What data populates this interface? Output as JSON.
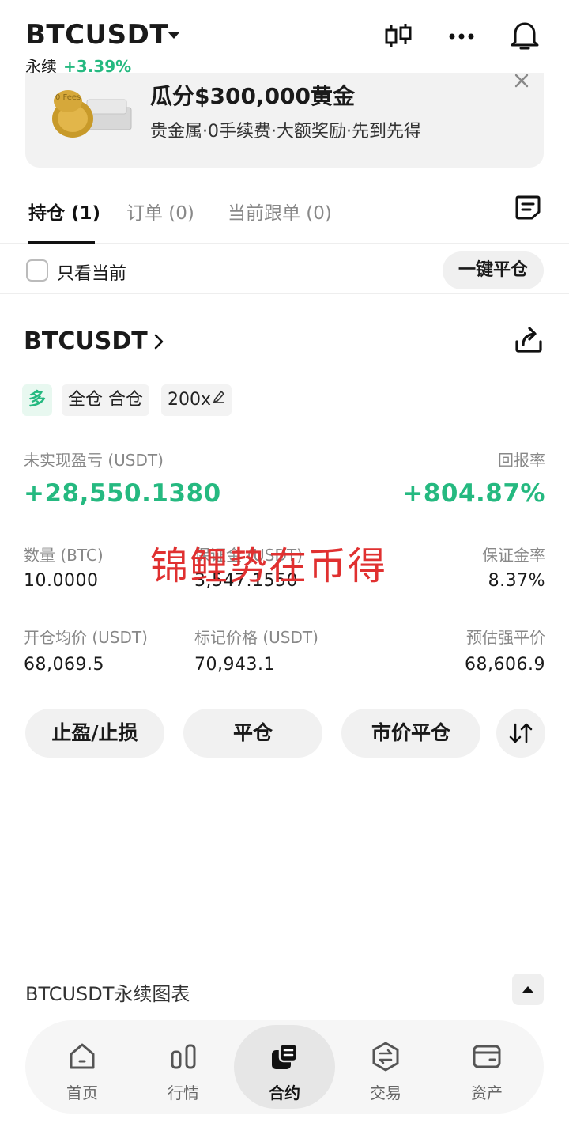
{
  "header": {
    "symbol": "BTCUSDT",
    "contract_type": "永续",
    "change_pct": "+3.39%"
  },
  "banner": {
    "title": "瓜分$300,000黄金",
    "description": "贵金属·0手续费·大额奖励·先到先得",
    "image_text": "0 Fees"
  },
  "tabs": [
    {
      "label": "持仓 (1)",
      "active": true
    },
    {
      "label": "订单 (0)",
      "active": false
    },
    {
      "label": "当前跟单 (0)",
      "active": false
    }
  ],
  "filter": {
    "checkbox_label": "只看当前",
    "close_all_label": "一键平仓"
  },
  "position": {
    "symbol": "BTCUSDT",
    "tags": [
      "多",
      "全仓 合仓",
      "200x"
    ],
    "pnl_label": "未实现盈亏 (USDT)",
    "pnl_value": "+28,550.1380",
    "roe_label": "回报率",
    "roe_value": "+804.87%",
    "fields": [
      {
        "label": "数量 (BTC)",
        "value": "10.0000"
      },
      {
        "label": "保证金 (USDT)",
        "value": "3,547.1550"
      },
      {
        "label": "保证金率",
        "value": "8.37%"
      },
      {
        "label": "开仓均价 (USDT)",
        "value": "68,069.5"
      },
      {
        "label": "标记价格 (USDT)",
        "value": "70,943.1"
      },
      {
        "label": "预估强平价",
        "value": "68,606.9"
      }
    ],
    "actions": [
      "止盈/止损",
      "平仓",
      "市价平仓"
    ]
  },
  "watermark": "锦鲤势在币得",
  "chart_bar": {
    "label": "BTCUSDT永续图表"
  },
  "bottom_nav": [
    {
      "label": "首页",
      "icon": "home-icon"
    },
    {
      "label": "行情",
      "icon": "market-icon"
    },
    {
      "label": "合约",
      "icon": "contract-icon",
      "active": true
    },
    {
      "label": "交易",
      "icon": "exchange-icon"
    },
    {
      "label": "资产",
      "icon": "wallet-icon"
    }
  ],
  "colors": {
    "accent_green": "#25b980",
    "watermark_red": "#e03030"
  }
}
